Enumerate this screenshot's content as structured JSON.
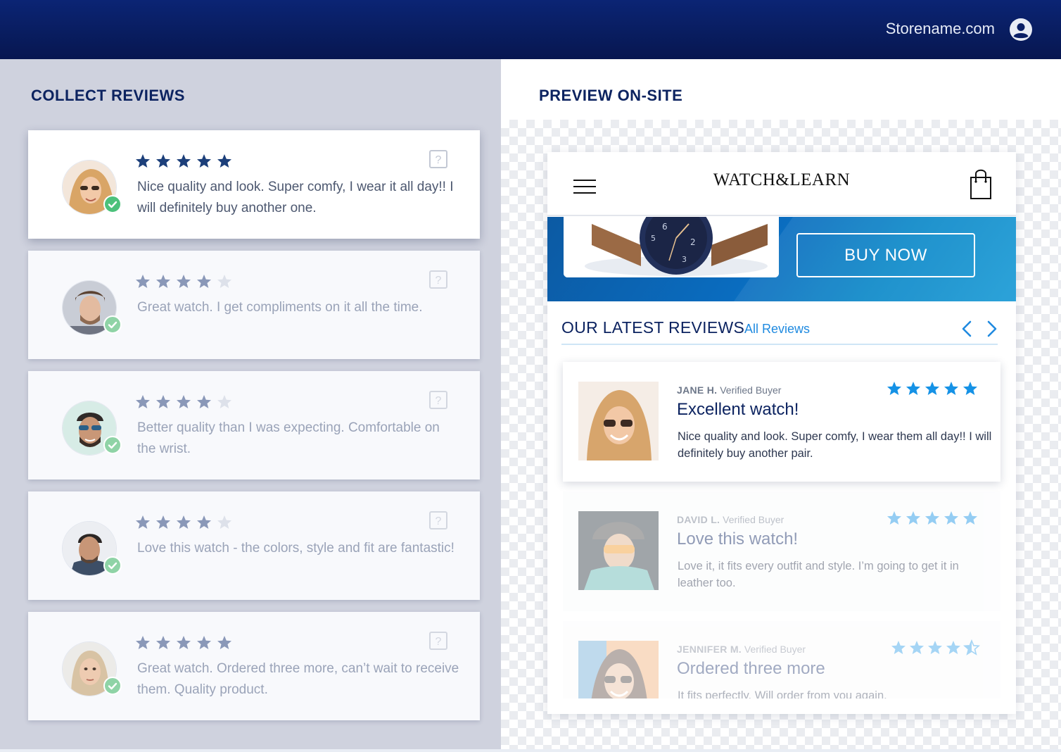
{
  "header": {
    "store_name": "Storename.com",
    "account_icon": "user-circle-icon",
    "background": "#071a5e"
  },
  "collect": {
    "title": "COLLECT REVIEWS",
    "reviews": [
      {
        "stars": 5,
        "text": "Nice quality and look. Super comfy, I wear it all day!! I will definitely buy another one.",
        "verified_icon": "check-icon",
        "help_icon": "question-icon",
        "active": true
      },
      {
        "stars": 4,
        "text": "Great watch. I get compliments on it all the time.",
        "verified_icon": "check-icon",
        "help_icon": "question-icon",
        "active": false
      },
      {
        "stars": 4,
        "text": "Better quality than I was expecting. Comfortable on the wrist.",
        "verified_icon": "check-icon",
        "help_icon": "question-icon",
        "active": false
      },
      {
        "stars": 4,
        "text": "Love this watch - the colors, style and fit are fantastic!",
        "verified_icon": "check-icon",
        "help_icon": "question-icon",
        "active": false
      },
      {
        "stars": 5,
        "text": "Great watch. Ordered three more, can’t wait to receive them. Quality product.",
        "verified_icon": "check-icon",
        "help_icon": "question-icon",
        "active": false
      }
    ]
  },
  "preview": {
    "title": "PREVIEW ON-SITE",
    "site": {
      "brand": "WATCH&LEARN",
      "menu_icon": "hamburger-icon",
      "cart_icon": "shopping-bag-icon",
      "cta_label": "BUY NOW",
      "section_title": "OUR LATEST REVIEWS",
      "all_reviews_link": "All Reviews",
      "prev_icon": "chevron-left-icon",
      "next_icon": "chevron-right-icon",
      "reviews": [
        {
          "name": "JANE H.",
          "badge": "Verified Buyer",
          "title": "Excellent watch!",
          "body": "Nice quality and look. Super comfy, I wear them all day!! I will definitely buy another pair.",
          "stars": 5
        },
        {
          "name": "DAVID L.",
          "badge": "Verified Buyer",
          "title": "Love this watch!",
          "body": "Love it, it fits every outfit and style. I’m going to get it in leather too.",
          "stars": 5
        },
        {
          "name": "JENNIFER M.",
          "badge": "Verified Buyer",
          "title": "Ordered three more",
          "body": "It fits perfectly. Will order from you again.",
          "stars": 4.5
        }
      ]
    }
  },
  "colors": {
    "navy": "#0c2360",
    "star_dark": "#1c3f7a",
    "star_light": "#1592e6",
    "accent_blue": "#1f8ae0",
    "verified_green": "#4cc17b"
  }
}
